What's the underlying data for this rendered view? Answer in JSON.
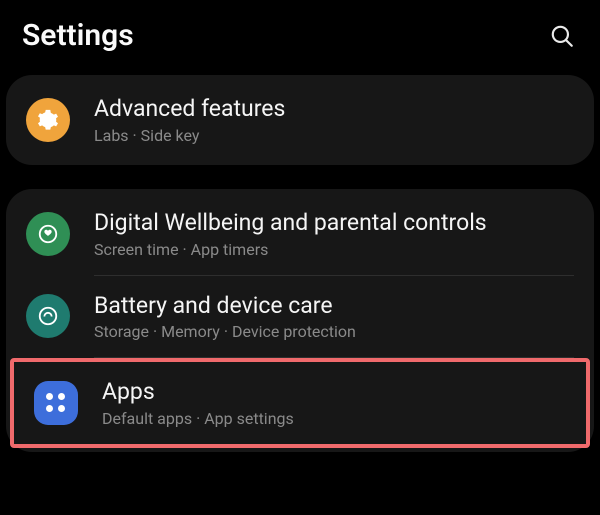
{
  "header": {
    "title": "Settings"
  },
  "group1": {
    "advanced": {
      "title": "Advanced features",
      "sub": "Labs  ·  Side key"
    }
  },
  "group2": {
    "wellbeing": {
      "title": "Digital Wellbeing and parental controls",
      "sub": "Screen time  ·  App timers"
    },
    "battery": {
      "title": "Battery and device care",
      "sub": "Storage  ·  Memory  ·  Device protection"
    },
    "apps": {
      "title": "Apps",
      "sub": "Default apps  ·  App settings"
    }
  }
}
